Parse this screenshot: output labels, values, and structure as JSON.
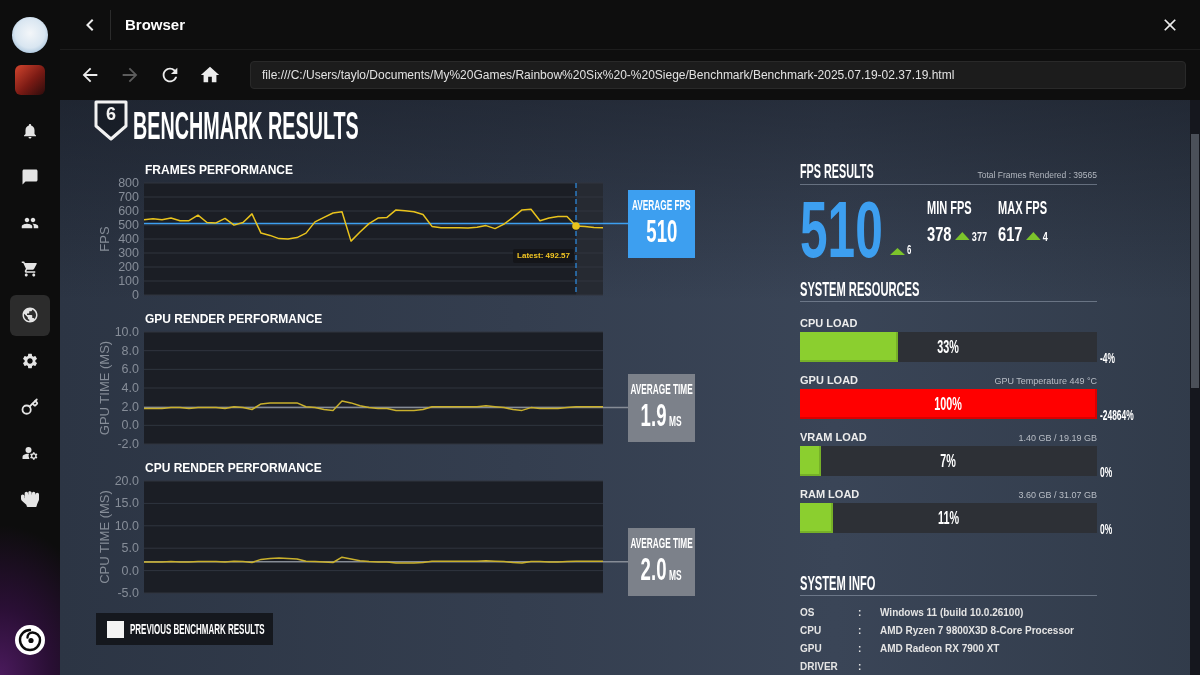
{
  "window": {
    "title": "Browser"
  },
  "sidebar": {
    "items": [
      {
        "selected": false
      },
      {
        "selected": false
      },
      {
        "selected": false
      },
      {
        "selected": false
      },
      {
        "selected": true
      },
      {
        "selected": false
      },
      {
        "selected": false
      },
      {
        "selected": false
      },
      {
        "selected": false
      }
    ]
  },
  "browser": {
    "nav": [
      {
        "disabled": false
      },
      {
        "disabled": true
      },
      {
        "disabled": false
      },
      {
        "disabled": false
      }
    ],
    "url": "file:///C:/Users/taylo/Documents/My%20Games/Rainbow%20Six%20-%20Siege/Benchmark/Benchmark-2025.07.19-02.37.19.html"
  },
  "page": {
    "logo_mark": "6",
    "title": "BENCHMARK RESULTS",
    "charts": [
      {
        "kind": "fps",
        "title": "FRAMES PERFORMANCE",
        "average": {
          "label": "AVERAGE FPS",
          "value": "510"
        },
        "chart_data": {
          "type": "line",
          "ylabel": "FPS",
          "ylim": [
            0,
            800
          ],
          "yticks": [
            0,
            100,
            200,
            300,
            400,
            500,
            600,
            700,
            800
          ],
          "grid": true,
          "series": [
            {
              "color": "#e9c31c",
              "values": [
                538,
                544,
                538,
                550,
                531,
                531,
                570,
                518,
                515,
                547,
                499,
                518,
                579,
                442,
                426,
                403,
                400,
                410,
                442,
                522,
                554,
                586,
                595,
                385,
                450,
                510,
                549,
                554,
                608,
                602,
                595,
                575,
                490,
                480,
                480,
                480,
                478,
                484,
                496,
                474,
                506,
                554,
                608,
                612,
                530,
                550,
                560,
                560,
                493,
                490,
                483,
                480
              ]
            }
          ],
          "ref_lines": [
            {
              "axis": "y",
              "value": 510
            }
          ],
          "annotations": [
            "Latest: 492.57"
          ]
        }
      },
      {
        "kind": "time",
        "title": "GPU RENDER PERFORMANCE",
        "average": {
          "label": "AVERAGE TIME",
          "value": "1.9",
          "unit": "MS"
        },
        "chart_data": {
          "type": "line",
          "ylabel": "GPU TIME (MS)",
          "ylim": [
            -2,
            10
          ],
          "yticks": [
            {
              "value": -2,
              "label": "-2.0"
            },
            {
              "value": 0,
              "label": "0.0"
            },
            {
              "value": 2,
              "label": "2.0"
            },
            {
              "value": 4,
              "label": "4.0"
            },
            {
              "value": 6,
              "label": "6.0"
            },
            {
              "value": 8,
              "label": "8.0"
            },
            {
              "value": 10,
              "label": "10.0"
            }
          ],
          "grid": true,
          "series": [
            {
              "color": "#c9b02c",
              "values": [
                1.8,
                1.8,
                1.8,
                1.9,
                1.9,
                1.8,
                1.9,
                1.9,
                1.9,
                1.8,
                2.0,
                1.9,
                1.7,
                2.3,
                2.4,
                2.4,
                2.4,
                2.4,
                2.0,
                1.9,
                1.7,
                1.6,
                2.6,
                2.4,
                2.1,
                1.9,
                1.8,
                1.8,
                1.6,
                1.6,
                1.6,
                1.7,
                2.0,
                2.0,
                2.0,
                2.0,
                2.0,
                2.0,
                2.1,
                2.0,
                1.9,
                1.7,
                1.6,
                1.9,
                1.8,
                1.8,
                1.8,
                1.9,
                2.0,
                2.0,
                2.0,
                2.0
              ]
            }
          ],
          "ref_lines": [
            {
              "axis": "y",
              "value": 1.9
            }
          ]
        }
      },
      {
        "kind": "time",
        "title": "CPU RENDER PERFORMANCE",
        "average": {
          "label": "AVERAGE TIME",
          "value": "2.0",
          "unit": "MS"
        },
        "chart_data": {
          "type": "line",
          "ylabel": "CPU TIME (MS)",
          "ylim": [
            -5,
            20
          ],
          "yticks": [
            {
              "value": -5,
              "label": "-5.0"
            },
            {
              "value": 0,
              "label": "0.0"
            },
            {
              "value": 5,
              "label": "5.0"
            },
            {
              "value": 10,
              "label": "10.0"
            },
            {
              "value": 15,
              "label": "15.0"
            },
            {
              "value": 20,
              "label": "20.0"
            }
          ],
          "grid": true,
          "series": [
            {
              "color": "#c9b02c",
              "values": [
                1.9,
                1.9,
                1.9,
                2.0,
                1.9,
                1.9,
                2.0,
                2.0,
                2.0,
                1.9,
                2.1,
                2.0,
                1.8,
                2.5,
                2.7,
                2.8,
                2.7,
                2.6,
                2.1,
                2.0,
                1.9,
                1.8,
                3.0,
                2.6,
                2.2,
                2.0,
                1.9,
                1.9,
                1.7,
                1.7,
                1.7,
                1.8,
                2.1,
                2.1,
                2.1,
                2.1,
                2.1,
                2.1,
                2.2,
                2.1,
                2.0,
                1.8,
                1.7,
                2.0,
                2.0,
                1.9,
                1.9,
                2.0,
                2.1,
                2.1,
                2.1,
                2.1
              ]
            }
          ],
          "ref_lines": [
            {
              "axis": "y",
              "value": 2.0
            }
          ]
        }
      }
    ],
    "previous_results": {
      "label": "PREVIOUS BENCHMARK RESULTS",
      "checked": false
    }
  },
  "fps_results": {
    "title": "FPS RESULTS",
    "total_frames": "Total Frames Rendered : 39565",
    "average": {
      "value": "510",
      "rising": true,
      "delta": "6"
    },
    "stats": [
      {
        "label": "MIN FPS",
        "value": "378",
        "rising": true,
        "delta": "377"
      },
      {
        "label": "MAX FPS",
        "value": "617",
        "rising": true,
        "delta": "4"
      }
    ]
  },
  "system_resources": {
    "title": "SYSTEM RESOURCES",
    "items": [
      {
        "label": "CPU LOAD",
        "level": 0.33,
        "reading": "33%",
        "change": "-4%",
        "color": "#8bcf2f"
      },
      {
        "label": "GPU LOAD",
        "detail": "GPU Temperature 449 °C",
        "level": 1,
        "reading": "100%",
        "change": "-24864%",
        "color": "#ff0000"
      },
      {
        "label": "VRAM LOAD",
        "detail": "1.40 GB / 19.19 GB",
        "level": 0.07,
        "reading": "7%",
        "change": "0%",
        "color": "#8bcf2f"
      },
      {
        "label": "RAM LOAD",
        "detail": "3.60 GB / 31.07 GB",
        "level": 0.11,
        "reading": "11%",
        "change": "0%",
        "color": "#8bcf2f"
      }
    ]
  },
  "system_info": {
    "title": "SYSTEM INFO",
    "rows": [
      {
        "label": "OS",
        "separator": ":",
        "value": "Windows 11 (build 10.0.26100)"
      },
      {
        "label": "CPU",
        "separator": ":",
        "value": "AMD Ryzen 7 9800X3D 8-Core Processor"
      },
      {
        "label": "GPU",
        "separator": ":",
        "value": "AMD Radeon RX 7900 XT"
      },
      {
        "label": "DRIVER",
        "separator": ":"
      }
    ]
  }
}
